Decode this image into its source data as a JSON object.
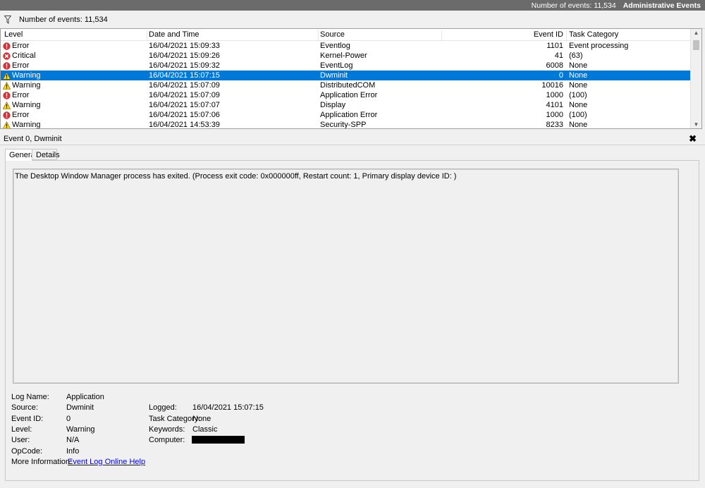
{
  "header": {
    "event_count": "Number of events: 11,534",
    "view_name": "Administrative Events"
  },
  "filter_bar": {
    "icon": "filter-icon",
    "event_count": "Number of events: 11,534"
  },
  "table": {
    "columns": {
      "level": "Level",
      "datetime": "Date and Time",
      "source": "Source",
      "event_id": "Event ID",
      "task_category": "Task Category"
    },
    "rows": [
      {
        "level": "Error",
        "datetime": "16/04/2021 15:09:33",
        "source": "Eventlog",
        "event_id": "1101",
        "task_category": "Event processing"
      },
      {
        "level": "Critical",
        "datetime": "16/04/2021 15:09:26",
        "source": "Kernel-Power",
        "event_id": "41",
        "task_category": "(63)"
      },
      {
        "level": "Error",
        "datetime": "16/04/2021 15:09:32",
        "source": "EventLog",
        "event_id": "6008",
        "task_category": "None"
      },
      {
        "level": "Warning",
        "datetime": "16/04/2021 15:07:15",
        "source": "Dwminit",
        "event_id": "0",
        "task_category": "None"
      },
      {
        "level": "Warning",
        "datetime": "16/04/2021 15:07:09",
        "source": "DistributedCOM",
        "event_id": "10016",
        "task_category": "None"
      },
      {
        "level": "Error",
        "datetime": "16/04/2021 15:07:09",
        "source": "Application Error",
        "event_id": "1000",
        "task_category": "(100)"
      },
      {
        "level": "Warning",
        "datetime": "16/04/2021 15:07:07",
        "source": "Display",
        "event_id": "4101",
        "task_category": "None"
      },
      {
        "level": "Error",
        "datetime": "16/04/2021 15:07:06",
        "source": "Application Error",
        "event_id": "1000",
        "task_category": "(100)"
      },
      {
        "level": "Warning",
        "datetime": "16/04/2021 14:53:39",
        "source": "Security-SPP",
        "event_id": "8233",
        "task_category": "None"
      }
    ],
    "selected_index": 3
  },
  "detail": {
    "title": "Event 0, Dwminit",
    "close_glyph": "✖",
    "tabs": [
      "General",
      "Details"
    ],
    "message": "The Desktop Window Manager process has exited. (Process exit code: 0x000000ff, Restart count: 1, Primary display device ID: )",
    "props": {
      "log_name_label": "Log Name:",
      "log_name": "Application",
      "source_label": "Source:",
      "source": "Dwminit",
      "logged_label": "Logged:",
      "logged": "16/04/2021 15:07:15",
      "event_id_label": "Event ID:",
      "event_id": "0",
      "task_category_label": "Task Category:",
      "task_category": "None",
      "level_label": "Level:",
      "level": "Warning",
      "keywords_label": "Keywords:",
      "keywords": "Classic",
      "user_label": "User:",
      "user": "N/A",
      "computer_label": "Computer:",
      "opcode_label": "OpCode:",
      "opcode": "Info",
      "more_info_label": "More Information:",
      "more_info_link": "Event Log Online Help"
    }
  },
  "colors": {
    "selection": "#0078d7",
    "error": "#d13438",
    "warning": "#ffd800",
    "link": "#0000ee"
  }
}
